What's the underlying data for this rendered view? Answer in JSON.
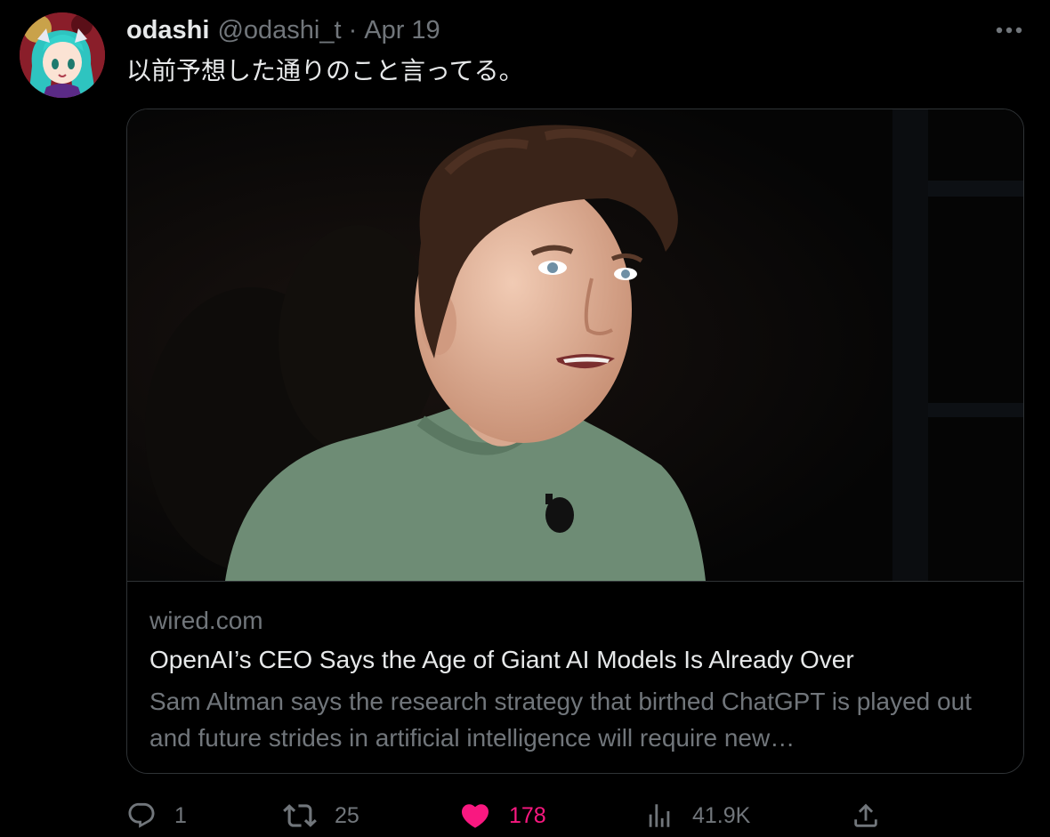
{
  "author": {
    "display_name": "odashi",
    "handle": "@odashi_t",
    "separator": "·",
    "date": "Apr 19"
  },
  "tweet": {
    "text": "以前予想した通りのこと言ってる。"
  },
  "card": {
    "domain": "wired.com",
    "title": "OpenAI’s CEO Says the Age of Giant AI Models Is Already Over",
    "description": "Sam Altman says the research strategy that birthed ChatGPT is played out and future strides in artificial intelligence will require new…"
  },
  "actions": {
    "replies": "1",
    "retweets": "25",
    "likes": "178",
    "views": "41.9K"
  },
  "colors": {
    "background": "#000000",
    "primary_text": "#e7e9ea",
    "secondary_text": "#71767b",
    "border": "#2f3336",
    "like_active": "#f91880"
  },
  "icons": {
    "more": "more-horizontal-icon",
    "reply": "reply-icon",
    "retweet": "retweet-icon",
    "like": "heart-filled-icon",
    "views": "analytics-icon",
    "share": "share-icon"
  }
}
